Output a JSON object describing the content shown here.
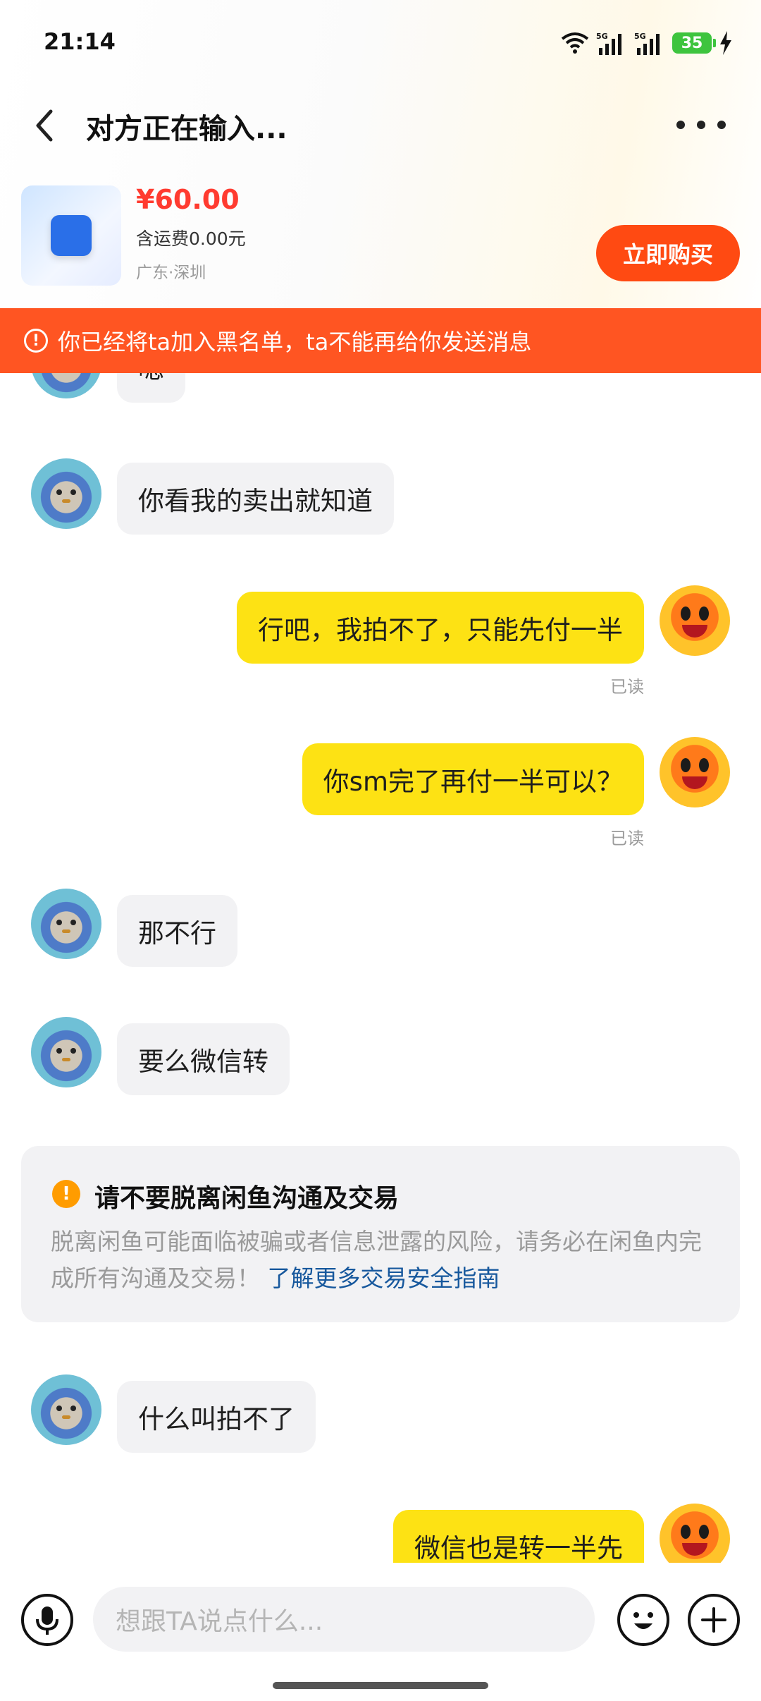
{
  "status_bar": {
    "time": "21:14",
    "battery": "35"
  },
  "header": {
    "title": "对方正在输入..."
  },
  "product": {
    "price": "¥60.00",
    "shipping": "含运费0.00元",
    "location": "广东·深圳",
    "buy_label": "立即购买"
  },
  "banner": {
    "text": "你已经将ta加入黑名单，ta不能再给你发送消息"
  },
  "messages": [
    {
      "side": "left",
      "text": "嗯"
    },
    {
      "side": "left",
      "text": "你看我的卖出就知道"
    },
    {
      "side": "right",
      "text": "行吧，我拍不了，只能先付一半",
      "status": "已读"
    },
    {
      "side": "right",
      "text": "你sm完了再付一半可以？",
      "status": "已读"
    },
    {
      "side": "left",
      "text": "那不行"
    },
    {
      "side": "left",
      "text": "要么微信转"
    },
    {
      "side": "left",
      "text": "什么叫拍不了"
    },
    {
      "side": "right",
      "text": "微信也是转一半先"
    }
  ],
  "notice": {
    "icon": "!",
    "title": "请不要脱离闲鱼沟通及交易",
    "body": "脱离闲鱼可能面临被骗或者信息泄露的风险，请务必在闲鱼内完成所有沟通及交易！",
    "link": "了解更多交易安全指南"
  },
  "input": {
    "placeholder": "想跟TA说点什么..."
  },
  "colors": {
    "banner": "#ff5522",
    "buy_button": "#ff4a12",
    "price": "#ff3b30",
    "my_bubble": "#fde214",
    "their_bubble": "#f2f2f4",
    "link": "#17589d"
  },
  "icons": {
    "back": "chevron-left-icon",
    "more": "more-dots-icon",
    "mic": "microphone-icon",
    "emoji": "emoji-icon",
    "plus": "plus-icon",
    "warning": "warning-icon",
    "wifi": "wifi-icon",
    "signal": "signal-icon",
    "battery": "battery-icon",
    "charging": "lightning-icon"
  }
}
